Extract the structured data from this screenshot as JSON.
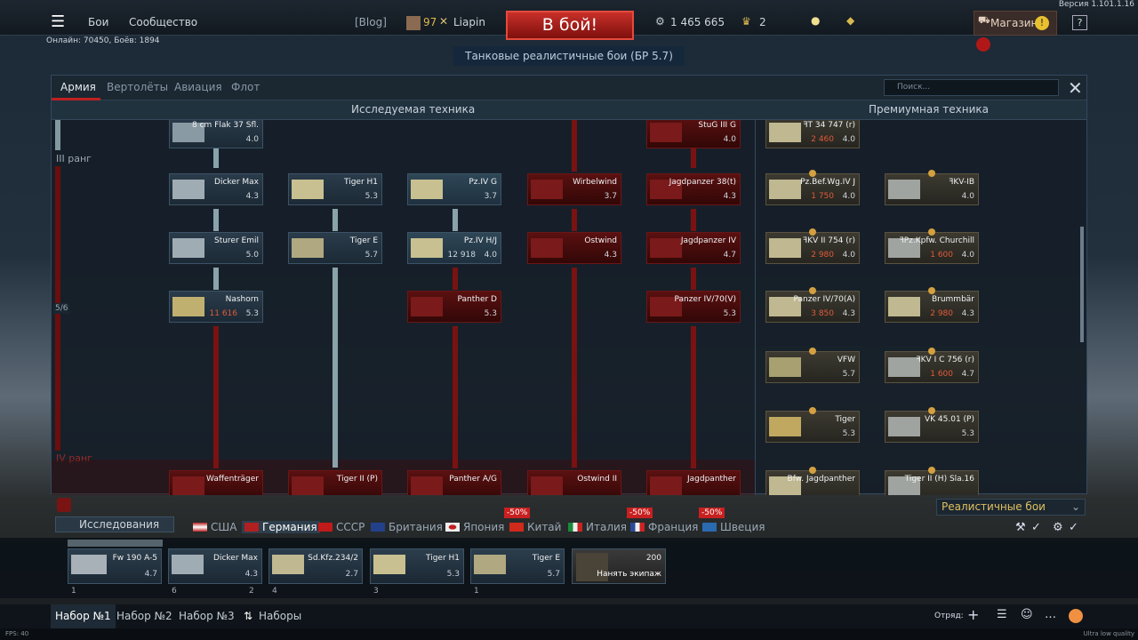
{
  "version": "Версия 1.101.1.16",
  "top": {
    "menu_icon": "hamburger-icon",
    "battles": "Бои",
    "community": "Сообщество",
    "blog": "[Blog]",
    "level": "97",
    "username": "Liapin",
    "battle_button": "В бой!",
    "silver": "1 465 665",
    "gold": "2",
    "shop": "Магазин",
    "help": "?",
    "online": "Онлайн: 70450, Боёв: 1894",
    "mode": "Танковые реалистичные бои (БР 5.7)"
  },
  "panel": {
    "tabs": [
      "Армия",
      "Вертолёты",
      "Авиация",
      "Флот"
    ],
    "search_placeholder": "Поиск...",
    "researched_header": "Исследуемая техника",
    "premium_header": "Премиумная техника",
    "rank3": "III ранг",
    "rank4": "IV ранг",
    "progress": "5/6"
  },
  "tree": [
    {
      "name": "8 cm Flak 37 Sfl.",
      "br": "4.0",
      "state": "researched"
    },
    {
      "name": "StuG III G",
      "br": "4.0",
      "state": "locked"
    },
    {
      "name": "Dicker Max",
      "br": "4.3",
      "state": "researched"
    },
    {
      "name": "Tiger H1",
      "br": "5.3",
      "state": "researched"
    },
    {
      "name": "Pz.IV G",
      "br": "3.7",
      "state": "researched"
    },
    {
      "name": "Wirbelwind",
      "br": "3.7",
      "state": "locked"
    },
    {
      "name": "Jagdpanzer 38(t)",
      "br": "4.3",
      "state": "locked"
    },
    {
      "name": "Sturer Emil",
      "br": "5.0",
      "state": "researched"
    },
    {
      "name": "Tiger E",
      "br": "5.7",
      "state": "researched"
    },
    {
      "name": "Pz.IV H/J",
      "br": "4.0",
      "state": "researching",
      "extra": "12 918"
    },
    {
      "name": "Ostwind",
      "br": "4.3",
      "state": "locked"
    },
    {
      "name": "Jagdpanzer IV",
      "br": "4.7",
      "state": "locked"
    },
    {
      "name": "Nashorn",
      "br": "5.3",
      "state": "researching",
      "extra": "11 616"
    },
    {
      "name": "Panther D",
      "br": "5.3",
      "state": "locked"
    },
    {
      "name": "Panzer IV/70(V)",
      "br": "5.3",
      "state": "locked"
    },
    {
      "name": "Waffenträger",
      "br": "",
      "state": "locked"
    },
    {
      "name": "Tiger II (P)",
      "br": "",
      "state": "locked"
    },
    {
      "name": "Panther A/G",
      "br": "",
      "state": "locked"
    },
    {
      "name": "Ostwind II",
      "br": "",
      "state": "locked"
    },
    {
      "name": "Jagdpanther",
      "br": "",
      "state": "locked"
    }
  ],
  "premium": [
    {
      "name": "ꟻT 34 747 (r)",
      "price": "2 460",
      "br": "4.0"
    },
    {
      "name": "Pz.Bef.Wg.IV J",
      "price": "1 750",
      "br": "4.0"
    },
    {
      "name": "ꟻKV-IB",
      "price": "",
      "br": "4.0"
    },
    {
      "name": "ꟻKV II 754 (r)",
      "price": "2 980",
      "br": "4.0"
    },
    {
      "name": "ꟻPz.Kpfw. Churchill",
      "price": "1 600",
      "br": "4.0"
    },
    {
      "name": "Panzer IV/70(A)",
      "price": "3 850",
      "br": "4.3"
    },
    {
      "name": "Brummbär",
      "price": "2 980",
      "br": "4.3"
    },
    {
      "name": "VFW",
      "price": "",
      "br": "5.7"
    },
    {
      "name": "ꟻKV I C 756 (r)",
      "price": "1 600",
      "br": "4.7"
    },
    {
      "name": "Tiger",
      "price": "",
      "br": "5.3"
    },
    {
      "name": "VK 45.01 (P)",
      "price": "",
      "br": "5.3"
    },
    {
      "name": "Bfw. Jagdpanther",
      "price": "",
      "br": ""
    },
    {
      "name": "Tiger II (H) Sla.16",
      "price": "",
      "br": ""
    }
  ],
  "filter": {
    "research_label": "Исследования",
    "mode_select": "Реалистичные бои"
  },
  "nations": [
    {
      "name": "США",
      "sale": ""
    },
    {
      "name": "Германия",
      "sale": ""
    },
    {
      "name": "СССР",
      "sale": ""
    },
    {
      "name": "Британия",
      "sale": ""
    },
    {
      "name": "Япония",
      "sale": ""
    },
    {
      "name": "Китай",
      "sale": "-50%"
    },
    {
      "name": "Италия",
      "sale": ""
    },
    {
      "name": "Франция",
      "sale": "-50%"
    },
    {
      "name": "Швеция",
      "sale": "-50%"
    }
  ],
  "crew": [
    {
      "name": "Fw 190 A-5",
      "br": "4.7",
      "num": "1"
    },
    {
      "name": "Dicker Max",
      "br": "4.3",
      "num": "6",
      "extra": "2"
    },
    {
      "name": "Sd.Kfz.234/2",
      "br": "2.7",
      "num": "4"
    },
    {
      "name": "Tiger H1",
      "br": "5.3",
      "num": "3"
    },
    {
      "name": "Tiger E",
      "br": "5.7",
      "num": "1"
    }
  ],
  "hire": {
    "price": "200",
    "label": "Нанять экипаж"
  },
  "presets": [
    "Набор №1",
    "Набор №2",
    "Набор №3",
    "Наборы"
  ],
  "squad": "Отряд:",
  "fps": "FPS: 40",
  "quality": "Ultra low quality"
}
